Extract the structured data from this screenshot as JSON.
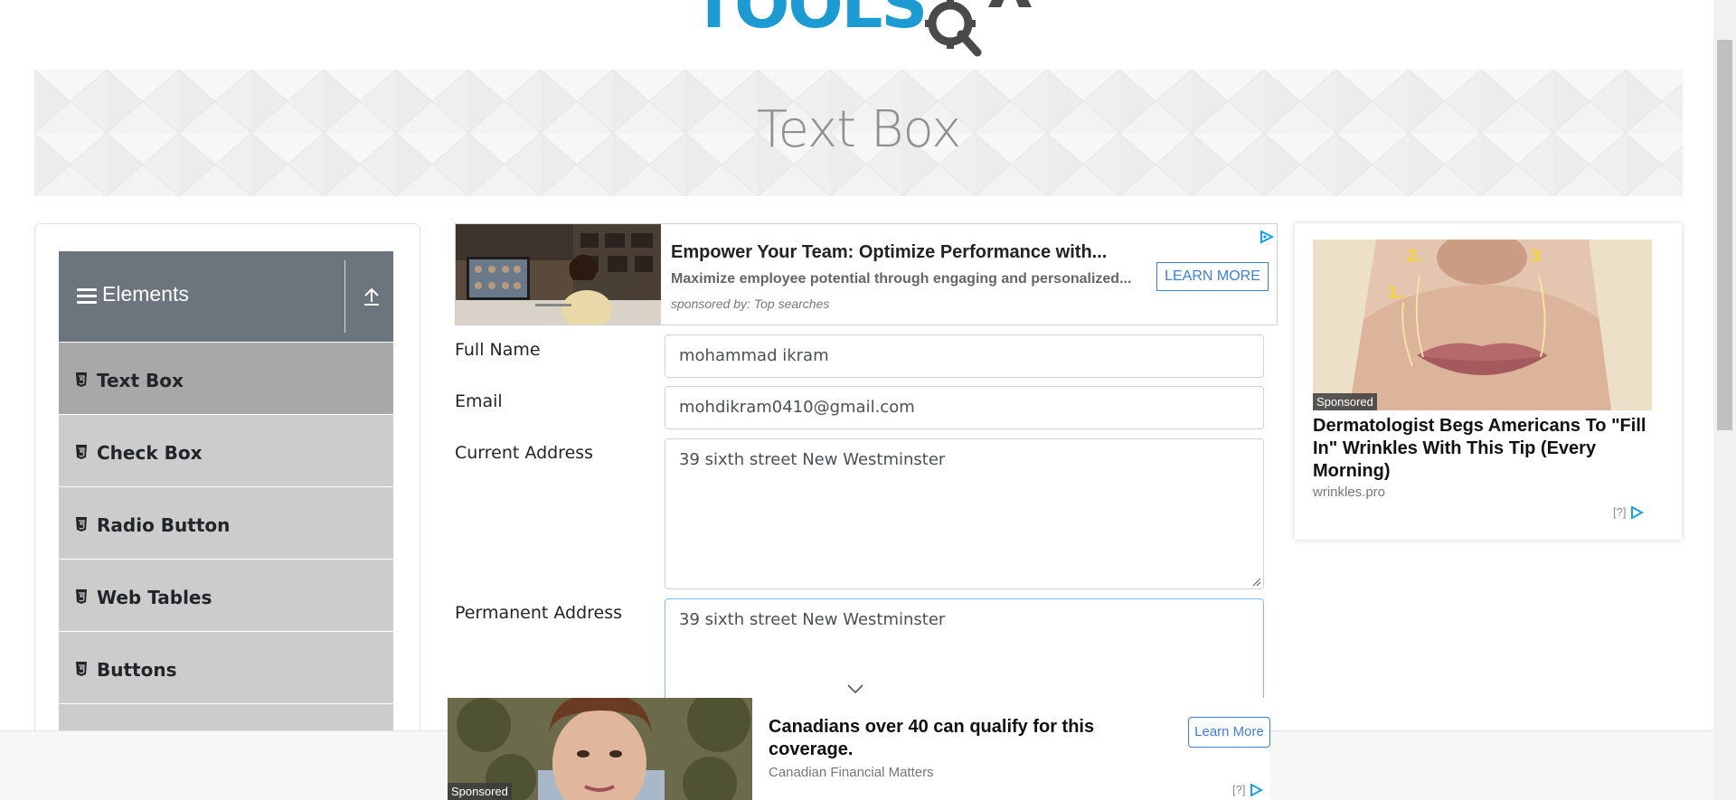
{
  "header": {
    "logo_text": "TOOLSQA"
  },
  "banner": {
    "title": "Text Box"
  },
  "sidebar": {
    "group_title": "Elements",
    "items": [
      {
        "label": "Text Box",
        "active": true
      },
      {
        "label": "Check Box",
        "active": false
      },
      {
        "label": "Radio Button",
        "active": false
      },
      {
        "label": "Web Tables",
        "active": false
      },
      {
        "label": "Buttons",
        "active": false
      }
    ]
  },
  "top_ad": {
    "headline": "Empower Your Team: Optimize Performance with...",
    "description": "Maximize employee potential through engaging and personalized...",
    "sponsor": "sponsored by: Top searches",
    "button_label": "LEARN MORE"
  },
  "form": {
    "full_name": {
      "label": "Full Name",
      "value": "mohammad ikram"
    },
    "email": {
      "label": "Email",
      "value": "mohdikram0410@gmail.com"
    },
    "current_address": {
      "label": "Current Address",
      "value": "39 sixth street New Westminster"
    },
    "permanent_address": {
      "label": "Permanent Address",
      "value": "39 sixth street New Westminster"
    }
  },
  "right_ad": {
    "sponsored_label": "Sponsored",
    "headline": "Dermatologist Begs Americans To \"Fill In\" Wrinkles With This Tip (Every Morning)",
    "domain": "wrinkles.pro",
    "help_mark": "[?]"
  },
  "bottom_ad": {
    "sponsored_label": "Sponsored",
    "headline": "Canadians over 40 can qualify for this coverage.",
    "source": "Canadian Financial Matters",
    "button_label": "Learn More",
    "help_mark": "[?]"
  },
  "colors": {
    "logo_blue": "#1b9bd1",
    "group_header_bg": "#6c757d",
    "menu_item_bg": "#cccccc",
    "menu_item_active_bg": "#a8a8a8",
    "ad_accent": "#3d7fd1"
  },
  "icons": {
    "menu": "hamburger-icon",
    "collapse": "arrow-up-icon",
    "menu_item": "html5-icon",
    "adchoices": "adchoices-icon",
    "scroll_hint": "chevron-down-icon"
  }
}
